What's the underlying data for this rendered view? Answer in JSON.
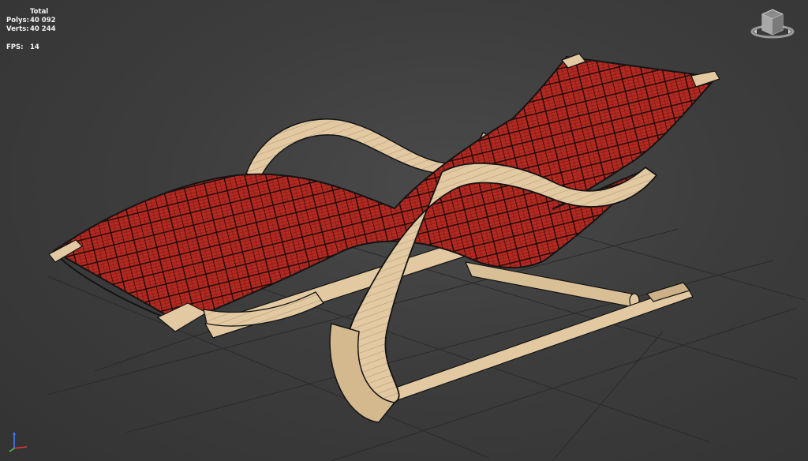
{
  "viewport_stats": {
    "header": "Total",
    "polys_label": "Polys:",
    "polys_value": "40 092",
    "verts_label": "Verts:",
    "verts_value": "40 244",
    "fps_label": "FPS:",
    "fps_value": "14"
  },
  "icons": {
    "viewcube": "viewcube-icon",
    "axis": "axis-tripod-icon"
  },
  "colors": {
    "background": "#3d3d3d",
    "grid_line": "#2a2a2a",
    "wood": "#e2c9a2",
    "wood_edge": "#b89c72",
    "webbing": "#b52a22",
    "webbing_dark": "#7a1a14",
    "outline": "#141414",
    "stats_text": "#f2f2f2"
  }
}
